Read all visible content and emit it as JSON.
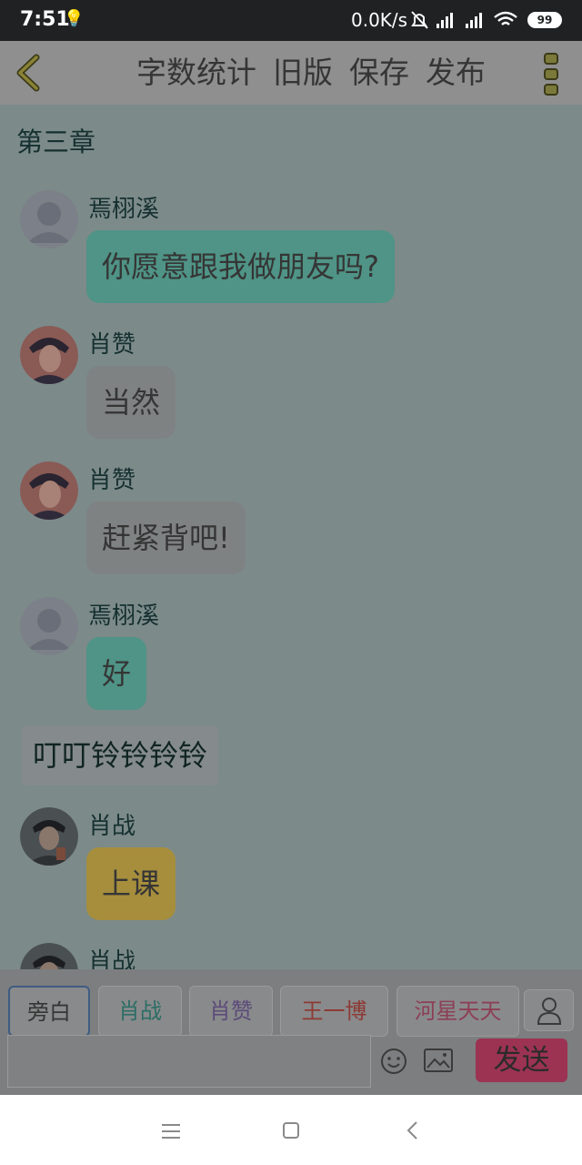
{
  "status_bar": {
    "time": "7:51",
    "network_speed": "0.0K/s",
    "battery": "99"
  },
  "toolbar": {
    "actions": [
      "字数统计",
      "旧版",
      "保存",
      "发布"
    ]
  },
  "chapter_title": "第三章",
  "messages": [
    {
      "sender": "焉栩溪",
      "text": "你愿意跟我做朋友吗?",
      "avatar": "default-avatar"
    },
    {
      "sender": "肖赞",
      "text": "当然",
      "avatar": "xiaozan-avatar"
    },
    {
      "sender": "肖赞",
      "text": "赶紧背吧!",
      "avatar": "xiaozan-avatar"
    },
    {
      "sender": "焉栩溪",
      "text": "好",
      "avatar": "default-avatar"
    },
    {
      "sender": "肖战",
      "text": "上课",
      "avatar": "xiaozhan-avatar"
    },
    {
      "sender": "肖战",
      "text": "",
      "avatar": "xiaozhan-avatar"
    }
  ],
  "narration": "叮叮铃铃铃铃",
  "roles": [
    {
      "label": "旁白",
      "color": "#353535"
    },
    {
      "label": "肖战",
      "color": "#2c6d66"
    },
    {
      "label": "肖赞",
      "color": "#5c4b7a"
    },
    {
      "label": "王一博",
      "color": "#8d3a35"
    },
    {
      "label": "河星天天",
      "color": "#8c3f56"
    }
  ],
  "send_label": "发送",
  "input_value": ""
}
